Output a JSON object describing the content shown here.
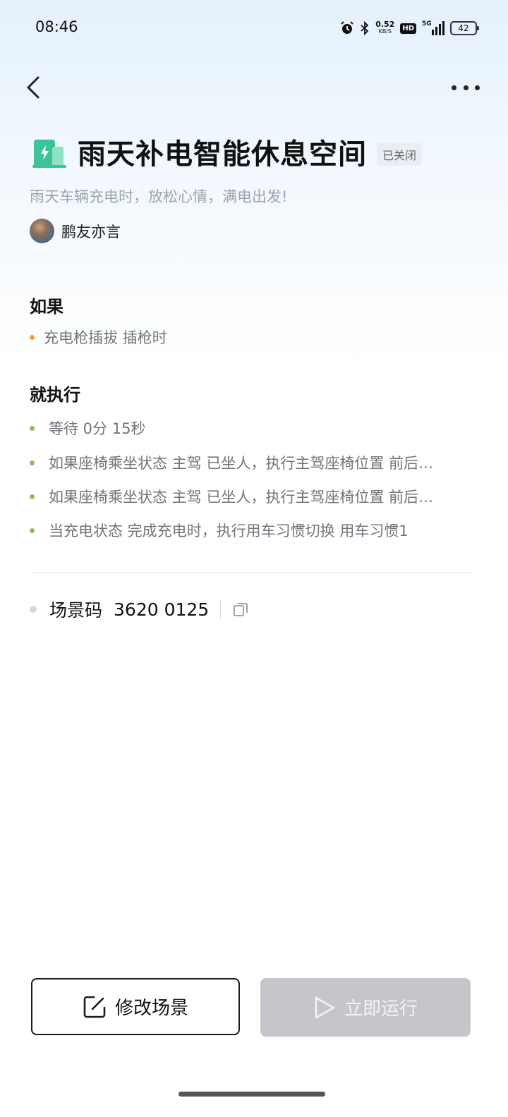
{
  "status_bar": {
    "time": "08:46",
    "net_speed_value": "0.52",
    "net_speed_unit": "KB/S",
    "hd": "HD",
    "network": "5G",
    "battery": "42",
    "icons": [
      "alarm-icon",
      "bluetooth-icon",
      "signal-icon",
      "battery-icon"
    ]
  },
  "nav": {
    "back_icon": "chevron-left-icon",
    "more_icon": "more-dots-icon"
  },
  "scene": {
    "title": "雨天补电智能休息空间",
    "status": "已关闭",
    "subtitle": "雨天车辆充电时，放松心情，满电出发!",
    "author": "鹏友亦言",
    "icon": "charging-station-icon",
    "icon_color": "#3cc39a"
  },
  "condition": {
    "title": "如果",
    "items": [
      "充电枪插拔 插枪时"
    ]
  },
  "actions": {
    "title": "就执行",
    "items": [
      "等待 0分 15秒",
      "如果座椅乘坐状态 主驾 已坐人，执行主驾座椅位置 前后…",
      "如果座椅乘坐状态 主驾 已坐人，执行主驾座椅位置 前后…",
      "当充电状态 完成充电时，执行用车习惯切换 用车习惯1"
    ]
  },
  "scene_code": {
    "label": "场景码",
    "value": "3620 0125"
  },
  "buttons": {
    "edit": "修改场景",
    "run": "立即运行",
    "run_disabled_color": "#c4c6c9"
  }
}
